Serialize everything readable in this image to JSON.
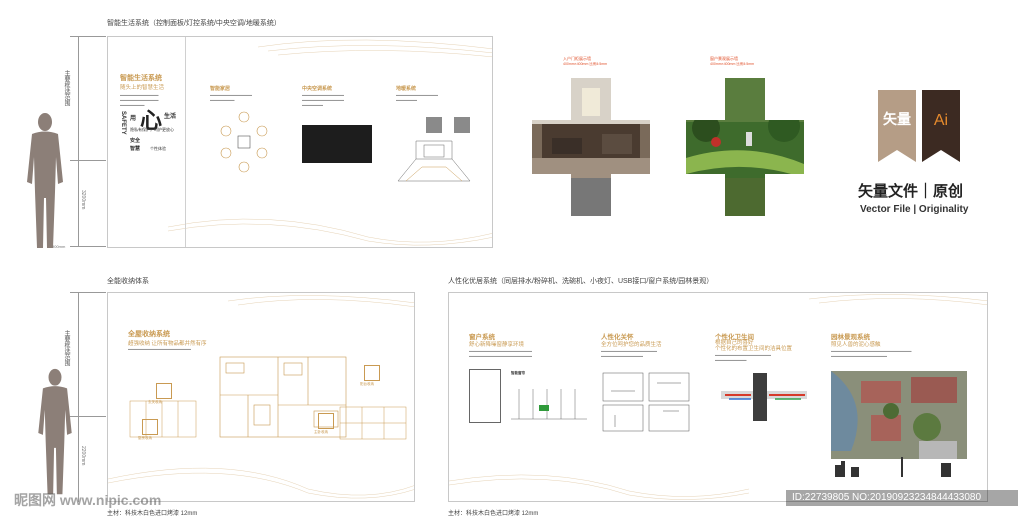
{
  "top_caption": "智能生活系统（控制面板/灯控系统/中央空调/地暖系统）",
  "top_panel": {
    "heading": "智能生活系统",
    "sub": "随头上的智慧生活",
    "big_char": "心",
    "left_chars": "SAFETY",
    "words": [
      "用",
      "生活",
      "安全",
      "智慧",
      "个性体验",
      "隐私有保护，呵护更放心"
    ],
    "sections": [
      {
        "title": "智能家居"
      },
      {
        "title": "中央空调系统"
      },
      {
        "title": "地暖系统"
      }
    ]
  },
  "left_ruler": {
    "label": "主要框选范围",
    "dim": "3200mm",
    "foot": "900mm"
  },
  "cross_images": [
    {
      "caption": "入户门柜展示墙",
      "dims": "400mm×400mm   比例4:5mm"
    },
    {
      "caption": "窗户景观展示墙",
      "dims": "400mm×400mm   比例4:5mm"
    }
  ],
  "badges": [
    {
      "text": "矢量",
      "color": "#b59d86"
    },
    {
      "text": "Ai",
      "color": "#3c2a22",
      "text_color": "#e58a2d"
    }
  ],
  "brand": {
    "title": "矢量文件｜原创",
    "subtitle": "Vector File | Originality"
  },
  "bottom_left_caption": "全能收纳体系",
  "bottom_right_caption": "人性化优居系统（同层排水/粉碎机、洗碗机、小夜灯、USB接口/窗户系统/园林景观）",
  "bottom_left_panel": {
    "title": "全屋收纳系统",
    "sub": "超强收纳  让所有物品都井然有序",
    "tags": [
      "玄关收纳",
      "厨房收纳",
      "阳台收纳",
      "主卧收纳",
      "衣帽收纳"
    ]
  },
  "bottom_right_panel": {
    "columns": [
      {
        "title": "窗户系统",
        "sub": "舒心新降噪窗静享环境"
      },
      {
        "title": "人性化关怀",
        "sub": "全方位呵护您的品质生活"
      },
      {
        "title": "个性化卫生间",
        "sub": "根据自己的喜好\n个性化的布置卫生间的洁具位置"
      },
      {
        "title": "园林景观系统",
        "sub": "照见人兽的泥心感触"
      }
    ],
    "small_label": "智能窗帘"
  },
  "bottom_left_ruler": {
    "label": "主要框选范围",
    "dim": "2200mm"
  },
  "footer_left": "主材：科技木白色进口烤漆 12mm",
  "footer_right": "主材：科技木白色进口烤漆 12mm",
  "watermark_left": "昵图网 www.nipic.com",
  "watermark_right": "ID:22739805 NO:20190923234844433080"
}
